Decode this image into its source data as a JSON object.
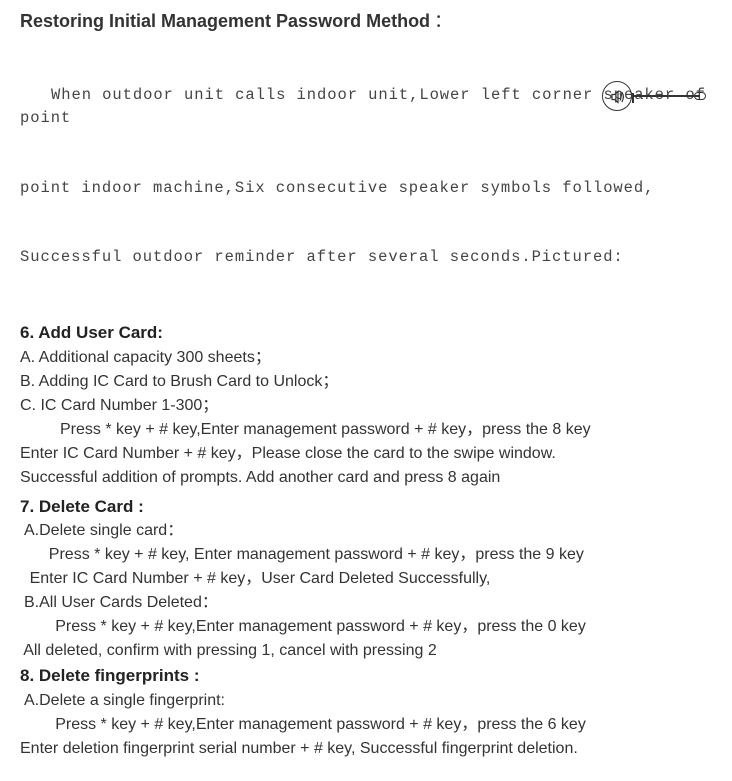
{
  "restore": {
    "title": "Restoring Initial Management Password Method",
    "colon": "：",
    "intro1": "When outdoor unit calls indoor unit,Lower left corner speaker of point",
    "intro2": "point indoor machine,Six consecutive speaker symbols followed,",
    "intro3": "Successful outdoor reminder after several seconds.Pictured:"
  },
  "sec6": {
    "title": "6. Add User Card:",
    "a": "A. Additional capacity 300 sheets；",
    "b": "B. Adding IC Card to Brush Card to Unlock；",
    "c": "C. IC Card Number 1-300；",
    "step1": "Press * key + # key,Enter management password + # key，press the 8 key",
    "step2": "Enter IC Card Number + # key，Please close the card to the swipe window.",
    "step3": "Successful addition of prompts. Add another card and press 8 again"
  },
  "sec7": {
    "title": "7. Delete Card :",
    "a": "A.Delete single card：",
    "a_step1": "Press * key + # key, Enter management password + # key，press the 9 key",
    "a_step2": "Enter IC Card Number + # key，User Card Deleted Successfully,",
    "b": "B.All User Cards Deleted：",
    "b_step1": "Press * key + # key,Enter management password + # key，press the 0 key",
    "b_step2": "All deleted, confirm with pressing 1, cancel with pressing 2"
  },
  "sec8": {
    "title": "8. Delete fingerprints :",
    "a": "A.Delete a single fingerprint:",
    "a_step1": "Press * key + # key,Enter management password + # key，press the 6 key",
    "a_step2": "Enter deletion fingerprint serial number + # key, Successful fingerprint deletion."
  },
  "icon": {
    "name": "speaker-icon"
  }
}
